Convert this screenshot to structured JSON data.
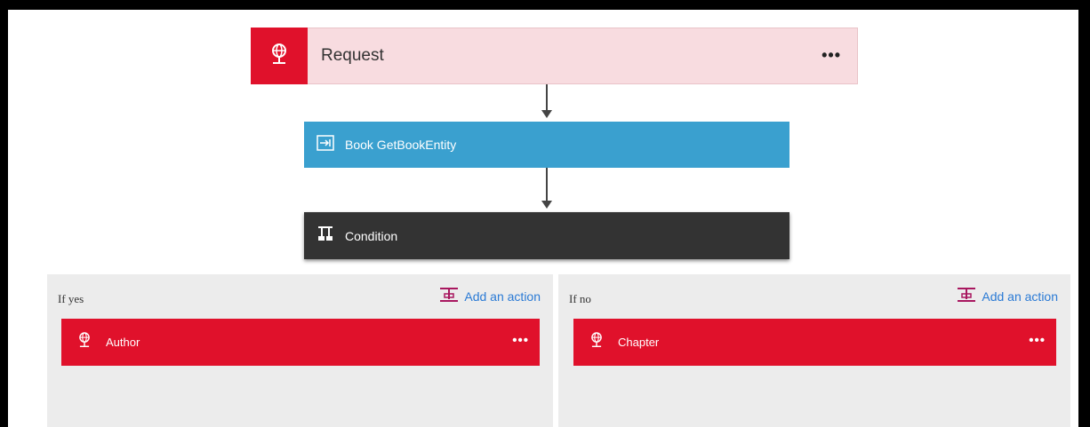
{
  "colors": {
    "request_icon_bg": "#e0112b",
    "request_bg": "#f8dce0",
    "action_blue": "#3aa0cf",
    "condition_bg": "#333333",
    "branch_card_red": "#e0112b",
    "link_blue": "#2a7ad5",
    "add_icon_color": "#a8175f"
  },
  "request": {
    "title": "Request",
    "more": "•••",
    "icon": "globe-icon"
  },
  "book": {
    "title": "Book GetBookEntity",
    "icon": "function-icon"
  },
  "condition": {
    "title": "Condition",
    "icon": "condition-icon"
  },
  "branches": {
    "yes": {
      "label": "If yes",
      "add_action": "Add an action",
      "card": {
        "title": "Author",
        "more": "•••",
        "icon": "globe-icon"
      }
    },
    "no": {
      "label": "If no",
      "add_action": "Add an action",
      "card": {
        "title": "Chapter",
        "more": "•••",
        "icon": "globe-icon"
      }
    }
  }
}
